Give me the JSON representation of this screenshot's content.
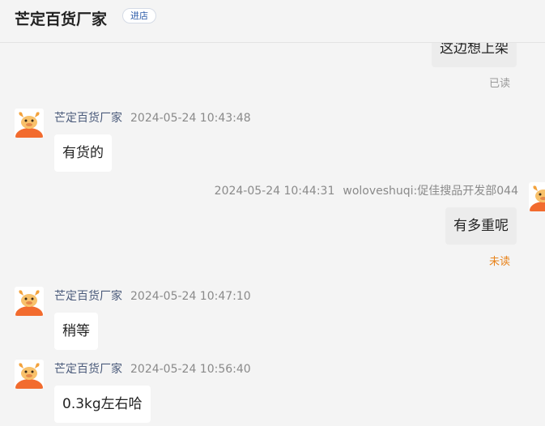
{
  "header": {
    "shop_name": "芒定百货厂家",
    "enter_label": "进店"
  },
  "messages": [
    {
      "direction": "out",
      "text": "这边想上架",
      "status": "已读"
    },
    {
      "direction": "in",
      "sender": "芒定百货厂家",
      "time": "2024-05-24 10:43:48",
      "text": "有货的"
    },
    {
      "direction": "out",
      "sender": "woloveshuqi:促佳搜品开发部044",
      "time": "2024-05-24 10:44:31",
      "text": "有多重呢",
      "status": "未读"
    },
    {
      "direction": "in",
      "sender": "芒定百货厂家",
      "time": "2024-05-24 10:47:10",
      "text": "稍等"
    },
    {
      "direction": "in",
      "sender": "芒定百货厂家",
      "time": "2024-05-24 10:56:40",
      "text": "0.3kg左右哈"
    }
  ],
  "colors": {
    "background": "#f4f4f4",
    "unread": "#e8831b",
    "enter_button_text": "#2b5aa8"
  }
}
